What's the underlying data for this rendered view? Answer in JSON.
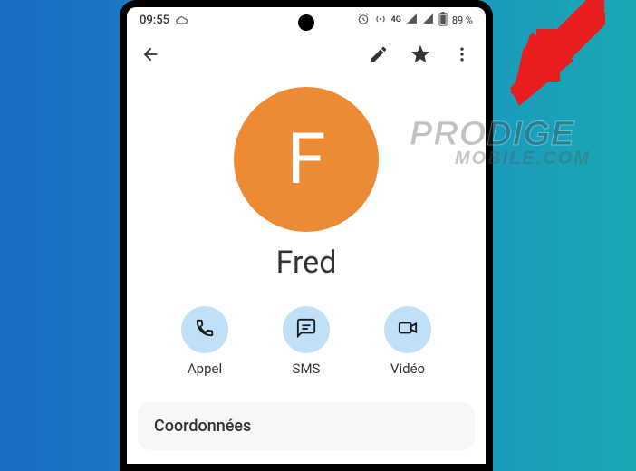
{
  "statusbar": {
    "time": "09:55",
    "network_label": "4G",
    "battery_text": "89 %"
  },
  "contact": {
    "initial": "F",
    "name": "Fred"
  },
  "actions": {
    "call": "Appel",
    "sms": "SMS",
    "video": "Vidéo"
  },
  "section": {
    "details_title": "Coordonnées"
  },
  "watermark": {
    "line1": "PRODIGE",
    "line2": "MOBILE.COM"
  }
}
